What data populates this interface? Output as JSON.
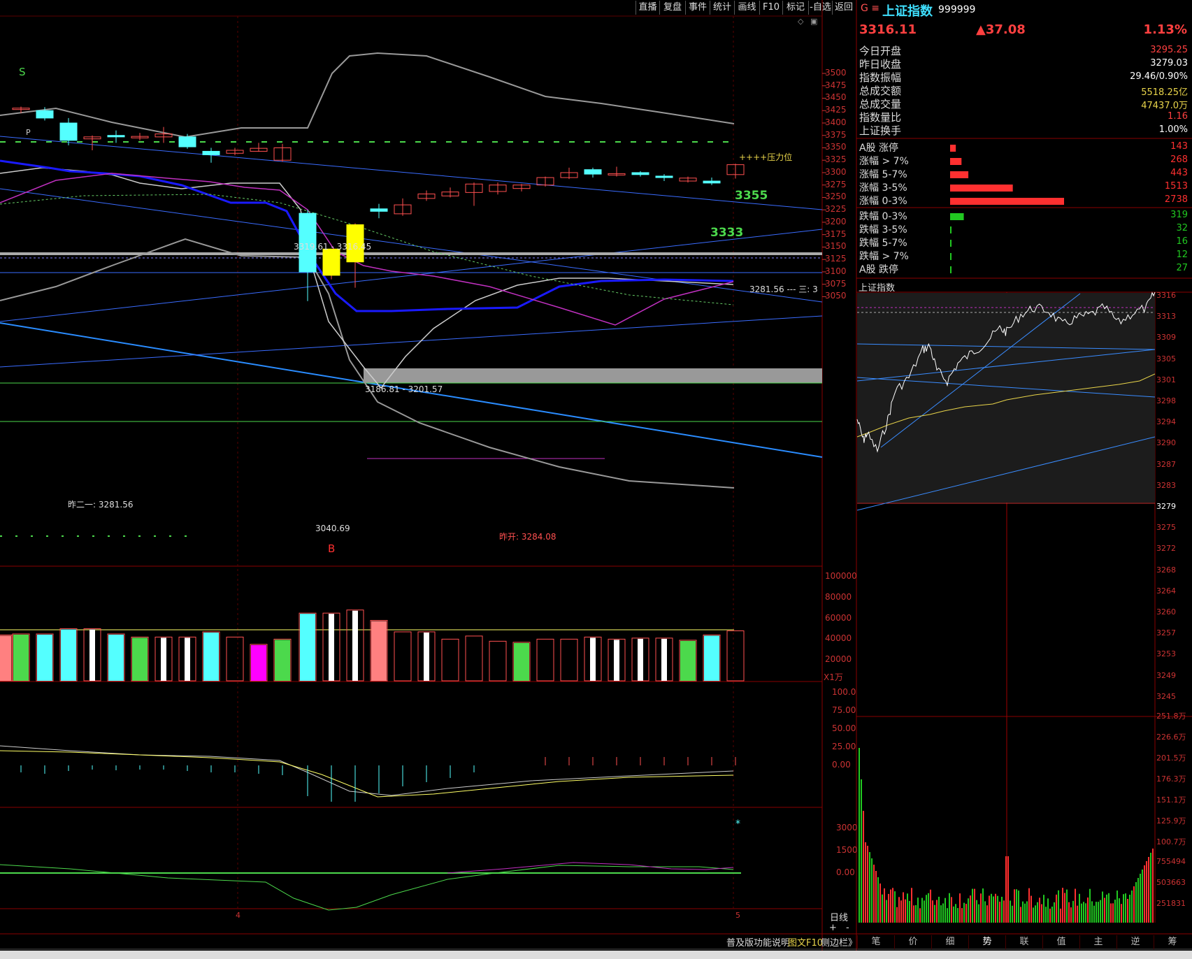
{
  "toolbar": {
    "buttons": [
      "直播",
      "复盘",
      "事件",
      "统计",
      "画线",
      "F10",
      "标记",
      "-自选",
      "返回"
    ]
  },
  "quote": {
    "menu_icon": "G ≡",
    "name": "上证指数",
    "code": "999999",
    "price": "3316.11",
    "change": "▲37.08",
    "change_pct": "1.13%"
  },
  "stats": [
    {
      "label": "今日开盘",
      "value": "3295.25",
      "color": "#ff4040"
    },
    {
      "label": "昨日收盘",
      "value": "3279.03",
      "color": "#ffffff"
    },
    {
      "label": "指数振幅",
      "value": "29.46/0.90%",
      "color": "#ffffff"
    },
    {
      "label": "总成交额",
      "value": "5518.25亿",
      "color": "#e8d44a"
    },
    {
      "label": "总成交量",
      "value": "47437.0万",
      "color": "#e8d44a"
    },
    {
      "label": "指数量比",
      "value": "1.16",
      "color": "#ff4040"
    },
    {
      "label": "上证换手",
      "value": "1.00%",
      "color": "#ffffff"
    }
  ],
  "breadth_up": [
    {
      "label": "A股 涨停",
      "count": "143",
      "ratio": 0.05
    },
    {
      "label": "涨幅 > 7%",
      "count": "268",
      "ratio": 0.1
    },
    {
      "label": "涨幅 5-7%",
      "count": "443",
      "ratio": 0.16
    },
    {
      "label": "涨幅 3-5%",
      "count": "1513",
      "ratio": 0.55
    },
    {
      "label": "涨幅 0-3%",
      "count": "2738",
      "ratio": 1.0
    }
  ],
  "breadth_down": [
    {
      "label": "跌幅 0-3%",
      "count": "319",
      "ratio": 0.12
    },
    {
      "label": "跌幅 3-5%",
      "count": "32",
      "ratio": 0.01
    },
    {
      "label": "跌幅 5-7%",
      "count": "16",
      "ratio": 0.005
    },
    {
      "label": "跌幅 > 7%",
      "count": "12",
      "ratio": 0.004
    },
    {
      "label": "A股 跌停",
      "count": "27",
      "ratio": 0.008
    }
  ],
  "mini_chart": {
    "title": "上证指数",
    "price_labels": [
      "3316",
      "3313",
      "3309",
      "3305",
      "3301",
      "3298",
      "3294",
      "3290",
      "3287",
      "3283",
      "3279",
      "3275",
      "3272",
      "3268",
      "3264",
      "3260",
      "3257",
      "3253",
      "3249",
      "3245"
    ],
    "volume_labels": [
      "251.8万",
      "226.6万",
      "201.5万",
      "176.3万",
      "151.1万",
      "125.9万",
      "100.7万",
      "755494",
      "503663",
      "251831"
    ]
  },
  "bottom_tabs": [
    "笔",
    "价",
    "细",
    "势",
    "联",
    "值",
    "主",
    "逆",
    "筹"
  ],
  "main_chart": {
    "price_axis": [
      "3500",
      "3475",
      "3450",
      "3425",
      "3400",
      "3375",
      "3350",
      "3325",
      "3300",
      "3275",
      "3250",
      "3225",
      "3200",
      "3175",
      "3150",
      "3125",
      "3100",
      "3075",
      "3050"
    ],
    "volume_axis": [
      "100000",
      "80000",
      "60000",
      "40000",
      "20000",
      "X1万"
    ],
    "macd_axis": [
      "100.0",
      "75.00",
      "50.00",
      "25.00",
      "0.00"
    ],
    "ind_axis": [
      "3000",
      "1500",
      "0.00"
    ],
    "annotations": {
      "s_mark": "S",
      "b_mark": "B",
      "p_mark": "P",
      "pressure": "++++压力位",
      "level_3355": "3355",
      "level_3333": "3333",
      "range_top": "3319.61 - 3316.45",
      "range_gap": "3186.81 - 3201.57",
      "low_mark": "3040.69",
      "prev_label": "昨二一: 3281.56",
      "prev_open": "昨开: 3284.08",
      "right_mark": "3281.56  --- 三: 3",
      "date_4": "4",
      "date_5": "5",
      "period": "日线",
      "plus": "+",
      "minus": "-",
      "star": "*"
    },
    "footer": {
      "help": "普及版功能说明",
      "f10": "图文F10",
      "sidebar": "侧边栏》"
    }
  },
  "colors": {
    "up": "#ff5050",
    "down": "#54ffff",
    "grid": "#5a0000",
    "accent_green": "#4cd94c",
    "yellow": "#ffff00"
  }
}
